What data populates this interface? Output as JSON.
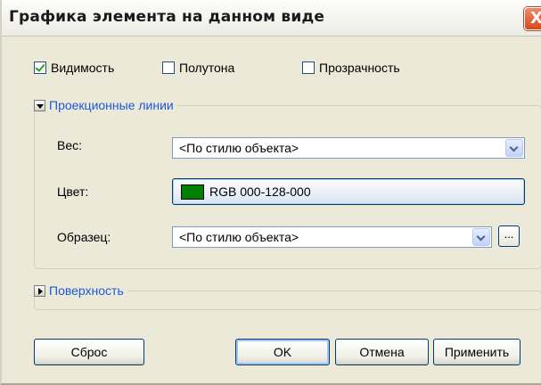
{
  "dialog": {
    "title": "Графика элемента на данном виде",
    "close_glyph": "X"
  },
  "checkboxes": [
    {
      "label": "Видимость",
      "checked": true
    },
    {
      "label": "Полутона",
      "checked": false
    },
    {
      "label": "Прозрачность",
      "checked": false
    }
  ],
  "projection_lines": {
    "title": "Проекционные линии",
    "expanded": true,
    "weight": {
      "label": "Вес:",
      "value": "<По стилю объекта>"
    },
    "color": {
      "label": "Цвет:",
      "value": "RGB 000-128-000",
      "swatch": "#008000"
    },
    "pattern": {
      "label": "Образец:",
      "value": "<По стилю объекта>",
      "browse_label": "..."
    }
  },
  "surface": {
    "title": "Поверхность",
    "expanded": false
  },
  "buttons": {
    "reset": "Сброс",
    "ok": "OK",
    "cancel": "Отмена",
    "apply": "Применить"
  },
  "theme": {
    "dialog_bg": "#ece9d8",
    "group_title_color": "#1c5ad6",
    "close_button": "#d9481f"
  }
}
